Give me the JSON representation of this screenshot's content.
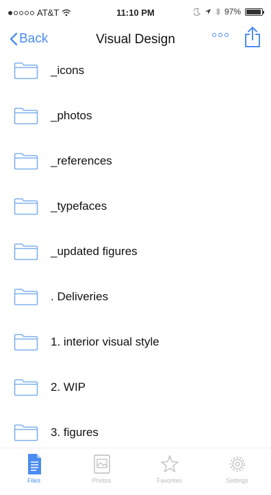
{
  "status_bar": {
    "carrier": "AT&T",
    "time": "11:10 PM",
    "battery": "97%"
  },
  "nav": {
    "back_label": "Back",
    "title": "Visual Design"
  },
  "folders": [
    {
      "name": "_icons"
    },
    {
      "name": "_photos"
    },
    {
      "name": "_references"
    },
    {
      "name": "_typefaces"
    },
    {
      "name": "_updated figures"
    },
    {
      "name": ". Deliveries"
    },
    {
      "name": "1. interior visual style"
    },
    {
      "name": "2. WIP"
    },
    {
      "name": "3. figures"
    }
  ],
  "tabs": [
    {
      "label": "Files",
      "icon": "files-icon",
      "active": true
    },
    {
      "label": "Photos",
      "icon": "photos-icon",
      "active": false
    },
    {
      "label": "Favorites",
      "icon": "star-icon",
      "active": false
    },
    {
      "label": "Settings",
      "icon": "gear-icon",
      "active": false
    }
  ],
  "colors": {
    "accent": "#4a8cf2",
    "folder_stroke": "#7fb0ee",
    "inactive_tab": "#bbbbbb"
  }
}
